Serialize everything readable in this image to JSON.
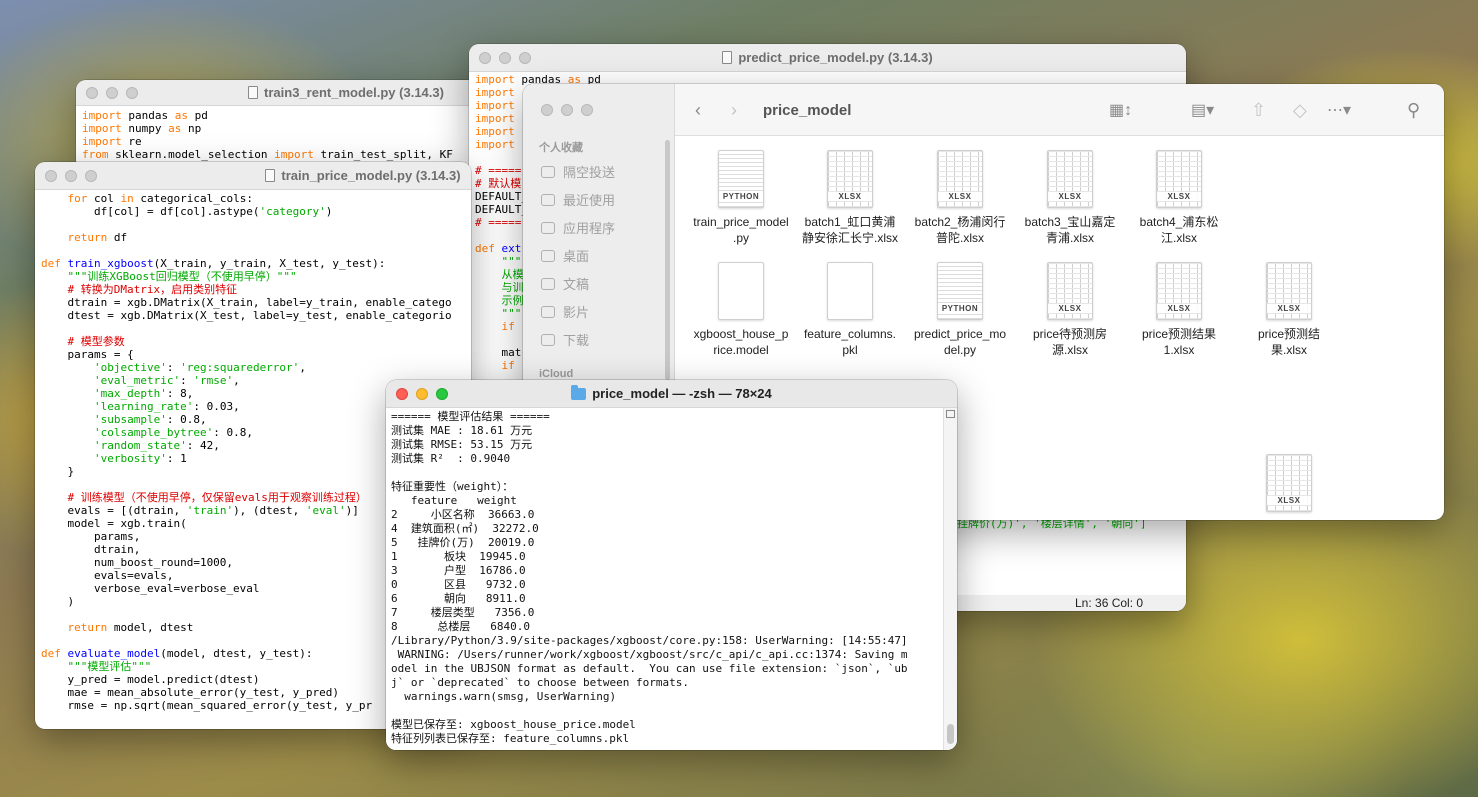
{
  "windows": {
    "rent_editor": {
      "title": "train3_rent_model.py (3.14.3)",
      "lines": [
        [
          {
            "t": "import",
            "c": "kw"
          },
          {
            "t": " pandas "
          },
          {
            "t": "as",
            "c": "kw"
          },
          {
            "t": " pd"
          }
        ],
        [
          {
            "t": "import",
            "c": "kw"
          },
          {
            "t": " numpy "
          },
          {
            "t": "as",
            "c": "kw"
          },
          {
            "t": " np"
          }
        ],
        [
          {
            "t": "import",
            "c": "kw"
          },
          {
            "t": " re"
          }
        ],
        [
          {
            "t": "from",
            "c": "kw"
          },
          {
            "t": " sklearn.model_selection "
          },
          {
            "t": "import",
            "c": "kw"
          },
          {
            "t": " train_test_split, KF"
          }
        ]
      ]
    },
    "price_editor": {
      "title": "train_price_model.py (3.14.3)",
      "lines": [
        [
          {
            "t": "    "
          },
          {
            "t": "for",
            "c": "kw"
          },
          {
            "t": " col "
          },
          {
            "t": "in",
            "c": "kw"
          },
          {
            "t": " categorical_cols:"
          }
        ],
        [
          {
            "t": "        df[col] = df[col].astype("
          },
          {
            "t": "'category'",
            "c": "str"
          },
          {
            "t": ")"
          }
        ],
        [
          {
            "t": ""
          }
        ],
        [
          {
            "t": "    "
          },
          {
            "t": "return",
            "c": "kw"
          },
          {
            "t": " df"
          }
        ],
        [
          {
            "t": ""
          }
        ],
        [
          {
            "t": "def",
            "c": "kw"
          },
          {
            "t": " "
          },
          {
            "t": "train_xgboost",
            "c": "def"
          },
          {
            "t": "(X_train, y_train, X_test, y_test):"
          }
        ],
        [
          {
            "t": "    "
          },
          {
            "t": "\"\"\"训练XGBoost回归模型（不使用早停）\"\"\"",
            "c": "str"
          }
        ],
        [
          {
            "t": "    "
          },
          {
            "t": "# 转换为DMatrix，启用类别特征",
            "c": "cmt"
          }
        ],
        [
          {
            "t": "    dtrain = xgb.DMatrix(X_train, label=y_train, enable_catego"
          }
        ],
        [
          {
            "t": "    dtest = xgb.DMatrix(X_test, label=y_test, enable_categorio"
          }
        ],
        [
          {
            "t": ""
          }
        ],
        [
          {
            "t": "    "
          },
          {
            "t": "# 模型参数",
            "c": "cmt"
          }
        ],
        [
          {
            "t": "    params = {"
          }
        ],
        [
          {
            "t": "        "
          },
          {
            "t": "'objective'",
            "c": "str"
          },
          {
            "t": ": "
          },
          {
            "t": "'reg:squarederror'",
            "c": "str"
          },
          {
            "t": ","
          }
        ],
        [
          {
            "t": "        "
          },
          {
            "t": "'eval_metric'",
            "c": "str"
          },
          {
            "t": ": "
          },
          {
            "t": "'rmse'",
            "c": "str"
          },
          {
            "t": ","
          }
        ],
        [
          {
            "t": "        "
          },
          {
            "t": "'max_depth'",
            "c": "str"
          },
          {
            "t": ": 8,"
          }
        ],
        [
          {
            "t": "        "
          },
          {
            "t": "'learning_rate'",
            "c": "str"
          },
          {
            "t": ": 0.03,"
          }
        ],
        [
          {
            "t": "        "
          },
          {
            "t": "'subsample'",
            "c": "str"
          },
          {
            "t": ": 0.8,"
          }
        ],
        [
          {
            "t": "        "
          },
          {
            "t": "'colsample_bytree'",
            "c": "str"
          },
          {
            "t": ": 0.8,"
          }
        ],
        [
          {
            "t": "        "
          },
          {
            "t": "'random_state'",
            "c": "str"
          },
          {
            "t": ": 42,"
          }
        ],
        [
          {
            "t": "        "
          },
          {
            "t": "'verbosity'",
            "c": "str"
          },
          {
            "t": ": 1"
          }
        ],
        [
          {
            "t": "    }"
          }
        ],
        [
          {
            "t": ""
          }
        ],
        [
          {
            "t": "    "
          },
          {
            "t": "# 训练模型（不使用早停，仅保留evals用于观察训练过程）",
            "c": "cmt"
          }
        ],
        [
          {
            "t": "    evals = [(dtrain, "
          },
          {
            "t": "'train'",
            "c": "str"
          },
          {
            "t": "), (dtest, "
          },
          {
            "t": "'eval'",
            "c": "str"
          },
          {
            "t": ")]"
          }
        ],
        [
          {
            "t": "    model = xgb.train("
          }
        ],
        [
          {
            "t": "        params,"
          }
        ],
        [
          {
            "t": "        dtrain,"
          }
        ],
        [
          {
            "t": "        num_boost_round=1000,"
          }
        ],
        [
          {
            "t": "        evals=evals,"
          }
        ],
        [
          {
            "t": "        verbose_eval=verbose_eval"
          }
        ],
        [
          {
            "t": "    )"
          }
        ],
        [
          {
            "t": ""
          }
        ],
        [
          {
            "t": "    "
          },
          {
            "t": "return",
            "c": "kw"
          },
          {
            "t": " model, dtest"
          }
        ],
        [
          {
            "t": ""
          }
        ],
        [
          {
            "t": "def",
            "c": "kw"
          },
          {
            "t": " "
          },
          {
            "t": "evaluate_model",
            "c": "def"
          },
          {
            "t": "(model, dtest, y_test):"
          }
        ],
        [
          {
            "t": "    "
          },
          {
            "t": "\"\"\"模型评估\"\"\"",
            "c": "str"
          }
        ],
        [
          {
            "t": "    y_pred = model.predict(dtest)"
          }
        ],
        [
          {
            "t": "    mae = mean_absolute_error(y_test, y_pred)"
          }
        ],
        [
          {
            "t": "    rmse = np.sqrt(mean_squared_error(y_test, y_pr"
          }
        ]
      ]
    },
    "predict_editor": {
      "title": "predict_price_model.py (3.14.3)",
      "lines": [
        [
          {
            "t": "import",
            "c": "kw"
          },
          {
            "t": " pandas "
          },
          {
            "t": "as",
            "c": "kw"
          },
          {
            "t": " pd"
          }
        ],
        [
          {
            "t": "import",
            "c": "kw"
          },
          {
            "t": " "
          }
        ],
        [
          {
            "t": "import",
            "c": "kw"
          },
          {
            "t": " "
          }
        ],
        [
          {
            "t": "import",
            "c": "kw"
          },
          {
            "t": " "
          }
        ],
        [
          {
            "t": "import",
            "c": "kw"
          },
          {
            "t": " "
          }
        ],
        [
          {
            "t": "import",
            "c": "kw"
          },
          {
            "t": " "
          }
        ],
        [
          {
            "t": ""
          }
        ],
        [
          {
            "t": "# =====",
            "c": "cmt"
          }
        ],
        [
          {
            "t": "# 默认模",
            "c": "cmt"
          }
        ],
        [
          {
            "t": "DEFAULT_"
          }
        ],
        [
          {
            "t": "DEFAULT_"
          }
        ],
        [
          {
            "t": "# =====",
            "c": "cmt"
          }
        ],
        [
          {
            "t": ""
          }
        ],
        [
          {
            "t": "def",
            "c": "kw"
          },
          {
            "t": " "
          },
          {
            "t": "ext",
            "c": "def"
          }
        ],
        [
          {
            "t": "    "
          },
          {
            "t": "\"\"\"",
            "c": "str"
          }
        ],
        [
          {
            "t": "    "
          },
          {
            "t": "从模",
            "c": "str"
          }
        ],
        [
          {
            "t": "    "
          },
          {
            "t": "与训",
            "c": "str"
          }
        ],
        [
          {
            "t": "    "
          },
          {
            "t": "示例",
            "c": "str"
          }
        ],
        [
          {
            "t": "    "
          },
          {
            "t": "\"\"\"",
            "c": "str"
          }
        ],
        [
          {
            "t": "    "
          },
          {
            "t": "if",
            "c": "kw"
          },
          {
            "t": " "
          }
        ],
        [
          {
            "t": ""
          }
        ],
        [
          {
            "t": "    mat"
          }
        ],
        [
          {
            "t": "    "
          },
          {
            "t": "if",
            "c": "kw"
          },
          {
            "t": " "
          }
        ]
      ],
      "fragment": "挂牌价(万)', '楼层详情', '朝向']",
      "status_line": "Ln: 36  Col: 0"
    },
    "finder": {
      "title": "price_model",
      "sidebar_heading": "个人收藏",
      "sidebar_items": [
        "隔空投送",
        "最近使用",
        "应用程序",
        "桌面",
        "文稿",
        "影片",
        "下载"
      ],
      "sidebar_icloud": "iCloud",
      "files": [
        {
          "name": "train_price_model\n.py",
          "kind": "py",
          "tag": "PYTHON"
        },
        {
          "name": "batch1_虹口黄浦\n静安徐汇长宁.xlsx",
          "kind": "xlsx",
          "tag": "XLSX"
        },
        {
          "name": "batch2_杨浦闵行\n普陀.xlsx",
          "kind": "xlsx",
          "tag": "XLSX"
        },
        {
          "name": "batch3_宝山嘉定\n青浦.xlsx",
          "kind": "xlsx",
          "tag": "XLSX"
        },
        {
          "name": "batch4_浦东松\n江.xlsx",
          "kind": "xlsx",
          "tag": "XLSX"
        },
        {
          "name": "xgboost_house_p\nrice.model",
          "kind": "blank",
          "tag": ""
        },
        {
          "name": "feature_columns.\npkl",
          "kind": "blank",
          "tag": ""
        },
        {
          "name": "predict_price_mo\ndel.py",
          "kind": "py",
          "tag": "PYTHON"
        },
        {
          "name": "price待预测房\n源.xlsx",
          "kind": "xlsx",
          "tag": "XLSX"
        },
        {
          "name": "price预测结果\n1.xlsx",
          "kind": "xlsx",
          "tag": "XLSX"
        },
        {
          "name": "price预测结\n果.xlsx",
          "kind": "xlsx",
          "tag": "XLSX"
        },
        {
          "name": "",
          "kind": "xlsx",
          "tag": "XLSX"
        }
      ]
    },
    "terminal": {
      "title": "price_model — -zsh — 78×24",
      "output": "====== 模型评估结果 ======\n测试集 MAE : 18.61 万元\n测试集 RMSE: 53.15 万元\n测试集 R²  : 0.9040\n\n特征重要性（weight）：\n   feature   weight\n2     小区名称  36663.0\n4  建筑面积(㎡)  32272.0\n5   挂牌价(万)  20019.0\n1       板块  19945.0\n3       户型  16786.0\n0       区县   9732.0\n6       朝向   8911.0\n7     楼层类型   7356.0\n8      总楼层   6840.0\n/Library/Python/3.9/site-packages/xgboost/core.py:158: UserWarning: [14:55:47]\n WARNING: /Users/runner/work/xgboost/xgboost/src/c_api/c_api.cc:1374: Saving m\nodel in the UBJSON format as default.  You can use file extension: `json`, `ub\nj` or `deprecated` to choose between formats.\n  warnings.warn(smsg, UserWarning)\n\n模型已保存至: xgboost_house_price.model\n特征列列表已保存至: feature_columns.pkl"
    }
  }
}
